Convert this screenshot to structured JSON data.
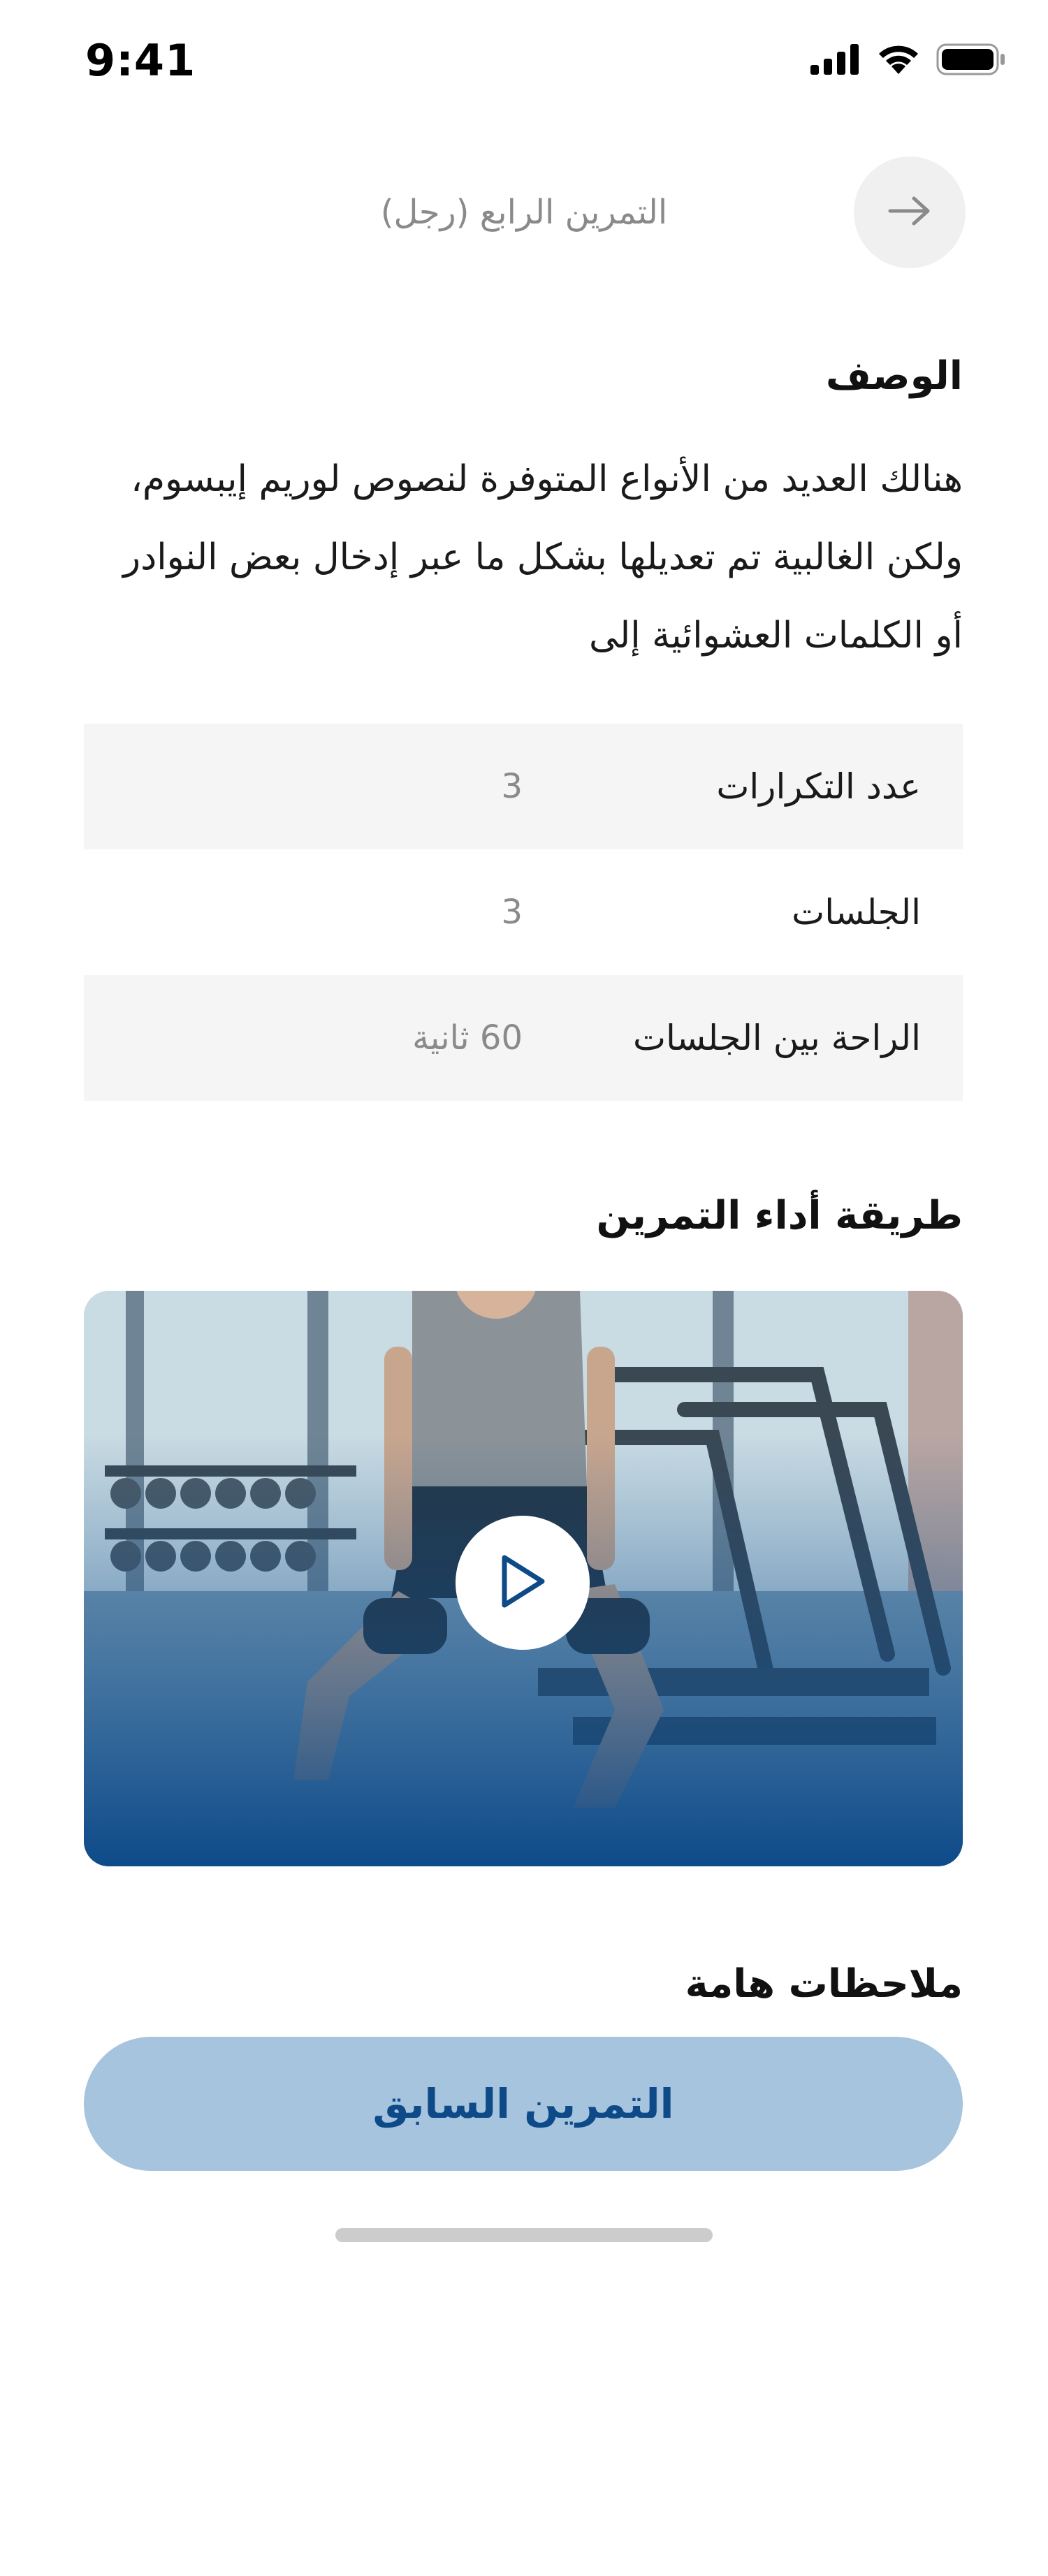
{
  "status_bar": {
    "time": "9:41",
    "icons": [
      "signal-icon",
      "wifi-icon",
      "battery-icon"
    ]
  },
  "header": {
    "title": "التمرين الرابع (رجل)",
    "back_icon": "arrow-right-icon"
  },
  "description": {
    "heading": "الوصف",
    "text": "هنالك العديد من الأنواع المتوفرة لنصوص لوريم إيبسوم، ولكن الغالبية تم تعديلها بشكل ما عبر إدخال بعض النوادر أو الكلمات العشوائية إلى"
  },
  "stats": [
    {
      "label": "عدد التكرارات",
      "value": "3"
    },
    {
      "label": "الجلسات",
      "value": "3"
    },
    {
      "label": "الراحة بين الجلسات",
      "value": "60 ثانية"
    }
  ],
  "method": {
    "heading": "طريقة أداء التمرين",
    "video_play_icon": "play-icon"
  },
  "notes": {
    "heading": "ملاحظات هامة"
  },
  "actions": {
    "previous_label": "التمرين السابق"
  },
  "colors": {
    "accent": "#0d4a87",
    "button_bg": "#a6c4de",
    "row_shade": "#f5f5f5",
    "muted_text": "#8a8a8a"
  }
}
